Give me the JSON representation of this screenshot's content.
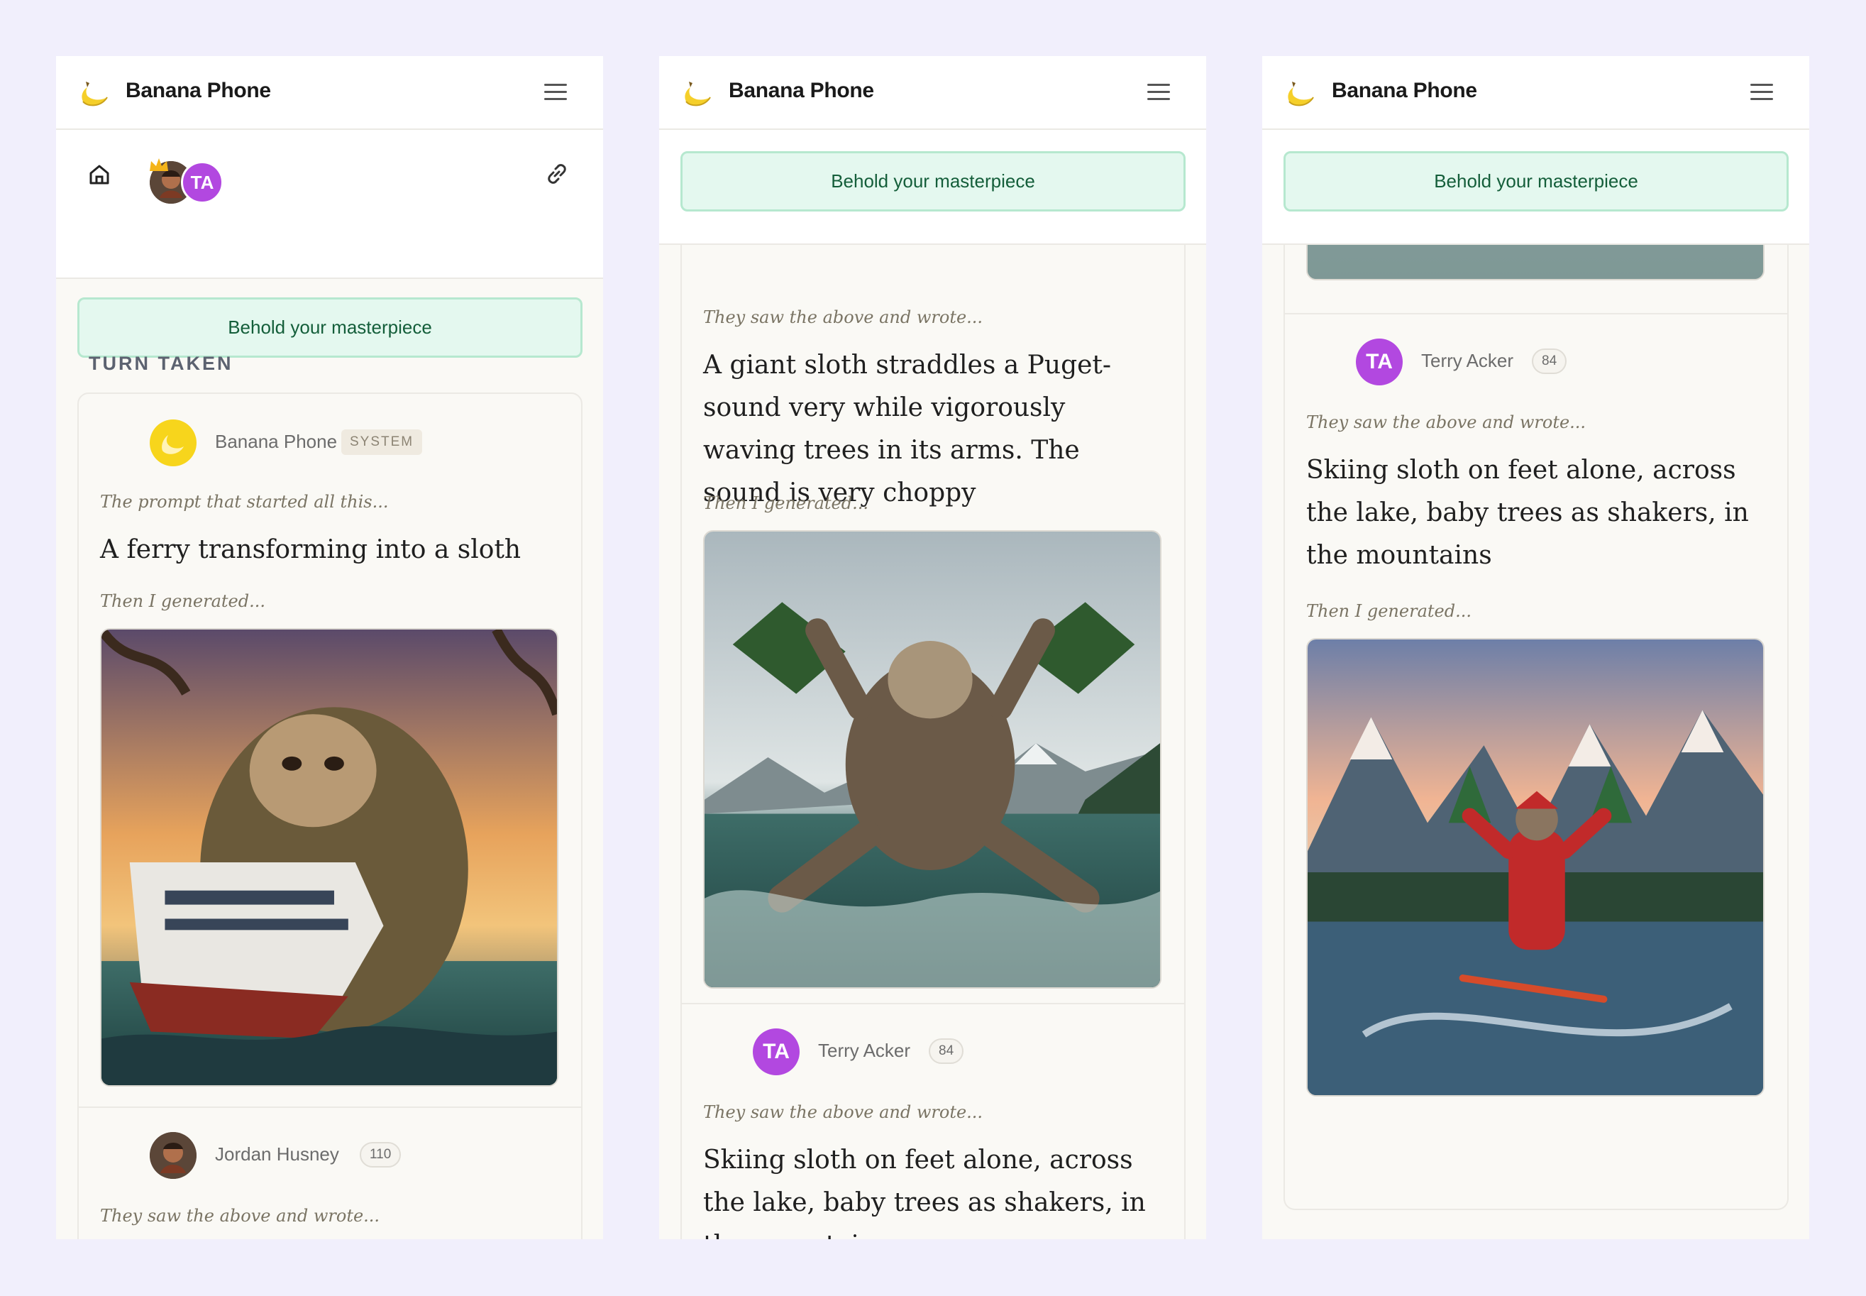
{
  "app": {
    "title": "Banana Phone",
    "menu_icon": "hamburger-menu-icon",
    "logo_icon": "banana-icon",
    "behold_label": "Behold your masterpiece",
    "section_title": "TURN TAKEN"
  },
  "toolbar": {
    "home_icon": "home-icon",
    "link_icon": "link-icon",
    "participants": [
      {
        "role": "winner",
        "initials": ""
      },
      {
        "role": "player",
        "initials": "TA"
      }
    ]
  },
  "turns": [
    {
      "author": "Banana Phone",
      "badge": "SYSTEM",
      "intro": "The prompt that started all this...",
      "prompt": "A ferry transforming into a sloth",
      "generated": "Then I generated...",
      "image_subject": "sloth-ferry-image"
    },
    {
      "author": "Jordan Husney",
      "badge": "110",
      "intro": "They saw the above and wrote...",
      "prompt": "A giant sloth straddles a Puget-sound very while vigorously waving trees in its arms. The sound is very choppy",
      "generated": "Then I generated...",
      "image_subject": "sloth-puget-sound-image"
    },
    {
      "author": "Terry Acker",
      "author_initials": "TA",
      "badge": "84",
      "intro": "They saw the above and wrote...",
      "prompt": "Skiing sloth on feet alone, across the lake, baby trees as shakers, in the mountains",
      "generated": "Then I generated...",
      "image_subject": "skiing-sloth-image"
    }
  ],
  "colors": {
    "accent_purple": "#b248e0",
    "behold_bg": "#e4f8ef",
    "behold_text": "#145e3a",
    "banana_yellow": "#f7d51c"
  }
}
